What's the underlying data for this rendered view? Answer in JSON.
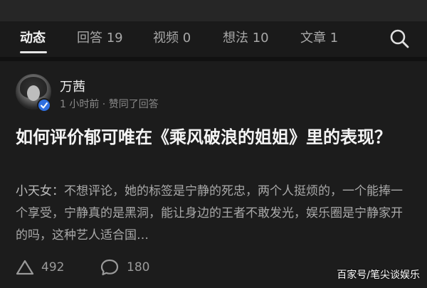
{
  "tabs": [
    {
      "label": "动态",
      "active": true
    },
    {
      "label": "回答 19",
      "active": false
    },
    {
      "label": "视频 0",
      "active": false
    },
    {
      "label": "想法 10",
      "active": false
    },
    {
      "label": "文章 1",
      "active": false
    }
  ],
  "search_icon": "search-icon",
  "post": {
    "username": "万茜",
    "meta": "1 小时前 · 赞同了回答",
    "question": "如何评价郁可唯在《乘风破浪的姐姐》里的表现？",
    "excerpt_author": "小天女：",
    "excerpt_text": "不想评论，她的标签是宁静的死忠，两个人挺烦的，一个能捧一个享受，宁静真的是黑洞，能让身边的王者不敢发光，娱乐圈是宁静家开的吗，这种艺人适合国…",
    "upvotes": "492",
    "comments": "180"
  },
  "watermark": "百家号/笔尖谈娱乐",
  "colors": {
    "background": "#1a1a1a",
    "verified_badge": "#2f6fe0"
  }
}
